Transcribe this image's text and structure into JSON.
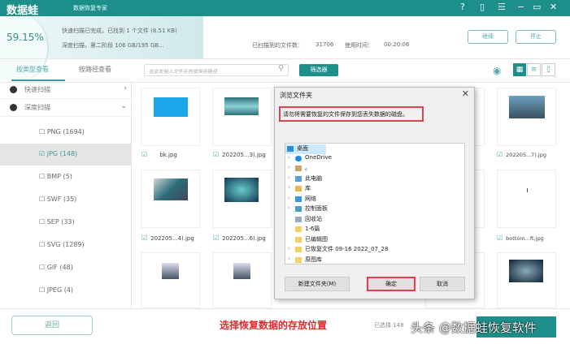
{
  "app": {
    "logo": "数据蛙",
    "subtitle": "数据恢复专家"
  },
  "window_controls": {
    "help": "?",
    "save": "▯",
    "menu": "☰",
    "minimize": "−",
    "maximize": "▭",
    "close": "✕"
  },
  "progress": {
    "percent": "59.15%",
    "line1": "快速扫描已完成，已找到 1 个文件 (8.51 KB)",
    "line2": "深度扫描，第二阶段 106 GB/195 GB...",
    "files_label": "已扫描到的文件数：",
    "files_value": "31706",
    "time_label": "使用时间：",
    "time_value": "00:20:06",
    "continue": "继续",
    "stop": "停止"
  },
  "tabs": [
    "按类型查看",
    "按路径查看"
  ],
  "search": {
    "placeholder": "在此处输入文件名称或保存路径"
  },
  "filter_label": "筛选器",
  "sidebar": {
    "quick_scan": "快速扫描",
    "deep_scan": "深度扫描",
    "types": [
      {
        "label": "PNG (1694)",
        "checked": false
      },
      {
        "label": "JPG (148)",
        "checked": true
      },
      {
        "label": "BMP (5)",
        "checked": false
      },
      {
        "label": "SWF (35)",
        "checked": false
      },
      {
        "label": "SEP (33)",
        "checked": false
      },
      {
        "label": "SVG (1289)",
        "checked": false
      },
      {
        "label": "GIF (48)",
        "checked": false
      },
      {
        "label": "JPEG (4)",
        "checked": false
      }
    ]
  },
  "files": [
    {
      "name": "bk.jpg"
    },
    {
      "name": "202205...3).jpg"
    },
    {
      "name": "202205...7).jpg"
    },
    {
      "name": "202205...4).jpg"
    },
    {
      "name": "202205...6).jpg"
    },
    {
      "name": "bottom...ft.jpg"
    }
  ],
  "dialog": {
    "title": "浏览文件夹",
    "message": "请勿将需要恢复的文件保存到您丢失数据的磁盘。",
    "tree": [
      "桌面",
      "OneDrive",
      "。",
      "此电脑",
      "库",
      "网络",
      "控制面板",
      "回收站",
      "1-6篇",
      "已编辑图",
      "已恢复文件 09-16 2022_07_28",
      "原图库"
    ],
    "new_folder": "新建文件夹(M)",
    "ok": "确定",
    "cancel": "取消"
  },
  "bottom": {
    "back": "返回",
    "caption": "选择恢复数据的存放位置",
    "selected": "已选择 148",
    "watermark": "头条 @数据蛙恢复软件"
  }
}
